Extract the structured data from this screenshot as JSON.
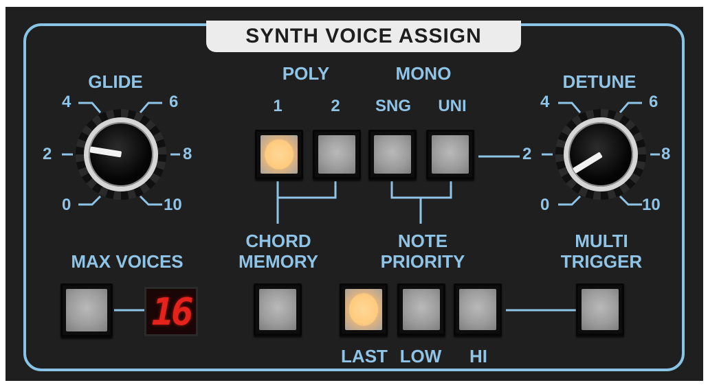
{
  "title": "SYNTH VOICE ASSIGN",
  "glide": {
    "label": "GLIDE",
    "ticks": {
      "t0": "0",
      "t2": "2",
      "t4": "4",
      "t6": "6",
      "t8": "8",
      "t10": "10"
    },
    "value": 2
  },
  "detune": {
    "label": "DETUNE",
    "ticks": {
      "t0": "0",
      "t2": "2",
      "t4": "4",
      "t6": "6",
      "t8": "8",
      "t10": "10"
    },
    "value": 0.5
  },
  "poly": {
    "label": "POLY",
    "b1": "1",
    "b2": "2"
  },
  "mono": {
    "label": "MONO",
    "sng": "SNG",
    "uni": "UNI"
  },
  "voice_mode_selected": "POLY 1",
  "chord_memory": {
    "line1": "CHORD",
    "line2": "MEMORY"
  },
  "note_priority": {
    "line1": "NOTE",
    "line2": "PRIORITY",
    "last": "LAST",
    "low": "LOW",
    "hi": "HI",
    "selected": "LAST"
  },
  "multi_trigger": {
    "line1": "MULTI",
    "line2": "TRIGGER"
  },
  "max_voices": {
    "label": "MAX VOICES",
    "display": "16"
  },
  "colors": {
    "accent": "#8fc4e6",
    "panel": "#1f1f1f",
    "led_on": "#fbc778",
    "display_red": "#e3231c"
  },
  "icons": {
    "knob": "rotary-knob",
    "button": "square-push-button",
    "display": "seven-segment-display"
  }
}
